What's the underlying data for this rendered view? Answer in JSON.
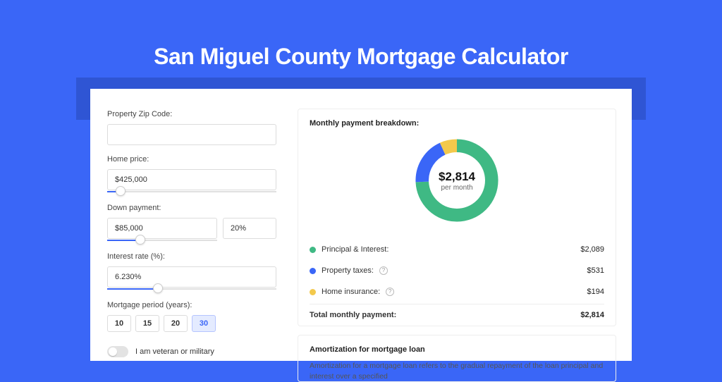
{
  "title": "San Miguel County Mortgage Calculator",
  "form": {
    "zip": {
      "label": "Property Zip Code:",
      "value": ""
    },
    "home_price": {
      "label": "Home price:",
      "value": "$425,000",
      "slider_pct": 8
    },
    "down_payment": {
      "label": "Down payment:",
      "amount": "$85,000",
      "percent": "20%",
      "slider_pct": 20
    },
    "interest_rate": {
      "label": "Interest rate (%):",
      "value": "6.230%",
      "slider_pct": 30
    },
    "period": {
      "label": "Mortgage period (years):",
      "options": [
        "10",
        "15",
        "20",
        "30"
      ],
      "selected": "30"
    },
    "veteran": {
      "label": "I am veteran or military"
    }
  },
  "breakdown": {
    "title": "Monthly payment breakdown:",
    "donut": {
      "amount": "$2,814",
      "subtitle": "per month"
    },
    "items": [
      {
        "label": "Principal & Interest:",
        "value": "$2,089",
        "color": "green",
        "info": false
      },
      {
        "label": "Property taxes:",
        "value": "$531",
        "color": "blue",
        "info": true
      },
      {
        "label": "Home insurance:",
        "value": "$194",
        "color": "yellow",
        "info": true
      }
    ],
    "total": {
      "label": "Total monthly payment:",
      "value": "$2,814"
    }
  },
  "chart_data": {
    "type": "pie",
    "title": "Monthly payment breakdown",
    "series": [
      {
        "name": "Principal & Interest",
        "value": 2089,
        "color": "#3FB984"
      },
      {
        "name": "Property taxes",
        "value": 531,
        "color": "#3A66F7"
      },
      {
        "name": "Home insurance",
        "value": 194,
        "color": "#F3C94C"
      }
    ],
    "total": 2814
  },
  "amortization": {
    "title": "Amortization for mortgage loan",
    "body": "Amortization for a mortgage loan refers to the gradual repayment of the loan principal and interest over a specified"
  }
}
